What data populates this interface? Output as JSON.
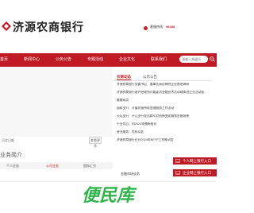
{
  "header": {
    "bank_name": "济源农商银行",
    "hotline_label": "客服热线：",
    "hotline_number": "96288"
  },
  "nav": {
    "items": [
      "首页",
      "新闻中心",
      "公务公告",
      "专题活动",
      "企业文化",
      "联系我们"
    ],
    "search_placeholder": "请输入关键词"
  },
  "news": {
    "tabs": [
      "农商动态",
      "公示公告"
    ],
    "items": [
      "济源农商银行党委书记、董事长高红梅到企业各地调研",
      "济源农商银行客户经理到开展走访金融宣传活动政策进企业活动报...",
      "最美网点",
      "面料支行：开展对接持续金融服务工作活动",
      "天坛支行：不让支行党员群众对创新变化解锁金融场景",
      "千百亿心：向2024年播新报讯",
      "营业服务：优化以此",
      "济源农商银行召开2024年NFTP工作推动会"
    ],
    "footer_date": "河北日报",
    "more_label": "查看更多"
  },
  "business": {
    "title": "业务简介",
    "columns": [
      "个人业务",
      "公司业务",
      "国际汇兑"
    ],
    "subtitle": "金融市场业务"
  },
  "ebank": {
    "personal": "个人网上银行入口",
    "corporate": "企业网上银行入口"
  },
  "watermark": {
    "text": "便民库"
  },
  "colors": {
    "brand_red": "#c01a24",
    "watermark_green": "#2fb34a"
  }
}
